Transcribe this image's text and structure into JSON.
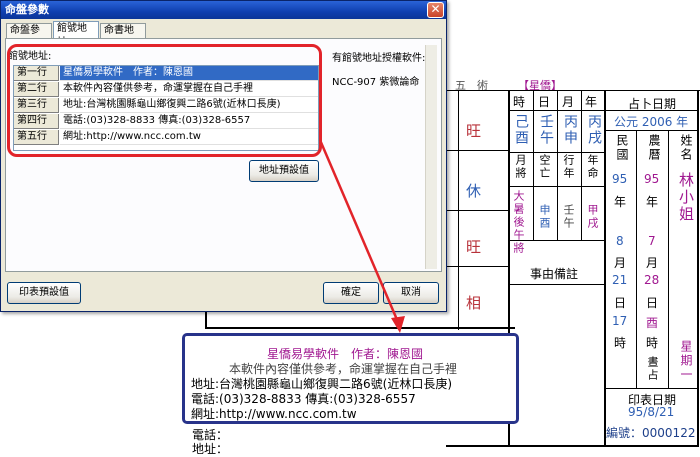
{
  "form": {
    "header_text": "五　術",
    "brand": "【星僑】",
    "cols": {
      "time": "時",
      "day": "日",
      "month": "月",
      "year": "年"
    },
    "pillars": {
      "time": "己酉",
      "day": "壬午",
      "month": "丙申",
      "year": "丙戌"
    },
    "row2_labels": {
      "a": "月將",
      "b": "空亡",
      "c": "行年",
      "d": "年命"
    },
    "row2_values": {
      "a": "大暑後午將",
      "b": "申酉",
      "c": "壬午",
      "d": "甲戌"
    },
    "event_notes": "事由備註",
    "left_chars": [
      "旺",
      "休",
      "旺",
      "相"
    ],
    "date_block": {
      "title": "占卜日期",
      "gregorian": "公元 2006 年",
      "roc_label": "民國",
      "lunar_label": "農曆",
      "name_label": "姓名",
      "roc_year": "95",
      "year_char": "年",
      "lunar_year": "95",
      "name_value": "林小姐",
      "roc_month": "8",
      "month_char": "月",
      "lunar_month": "7",
      "roc_day": "21",
      "day_char": "日",
      "lunar_day": "28",
      "roc_hour": "17",
      "hour_char": "時",
      "lunar_hour": "酉",
      "weekday": "星期一",
      "divination_type": "晝占",
      "print_date_label": "印表日期",
      "print_date": "95/8/21",
      "serial_label": "編號：",
      "serial": "0000122"
    },
    "footer_phone_label": "電話：",
    "footer_addr_label": "地址："
  },
  "dialog": {
    "title": "命盤參數",
    "tabs": [
      "命盤參數",
      "館號地址",
      "命書地址"
    ],
    "active_tab": 1,
    "group_label": "館號地址:",
    "rows": [
      {
        "label": "第一行",
        "value": "星僑易學軟件　作者：陳恩國"
      },
      {
        "label": "第二行",
        "value": "本軟件內容僅供參考，命運掌握在自己手裡"
      },
      {
        "label": "第三行",
        "value": "地址:台灣桃園縣龜山鄉復興二路6號(近林口長庚)"
      },
      {
        "label": "第四行",
        "value": "電話:(03)328-8833 傳真:(03)328-6557"
      },
      {
        "label": "第五行",
        "value": "網址:http://www.ncc.com.tw"
      }
    ],
    "auth_label": "有館號地址授權軟件:",
    "auth_value": "NCC-907 紫微論命",
    "default_addr_button": "地址預設值",
    "print_default_button": "印表預設值",
    "ok_button": "確定",
    "cancel_button": "取消"
  },
  "callout": {
    "line1": "星僑易學軟件　作者：陳恩國",
    "line2": "本軟件內容僅供參考，命運掌握在自己手裡",
    "line3": "地址:台灣桃園縣龜山鄉復興二路6號(近林口長庚)",
    "line4": "電話:(03)328-8833 傳真:(03)328-6557",
    "line5": "網址:http://www.ncc.com.tw"
  },
  "colors": {
    "highlight_red": "#e2242a",
    "callout_blue": "#28338a",
    "selection_blue": "#316ac5",
    "pillar_blue": "#2f5fb3",
    "accent_purple": "#a01890"
  }
}
